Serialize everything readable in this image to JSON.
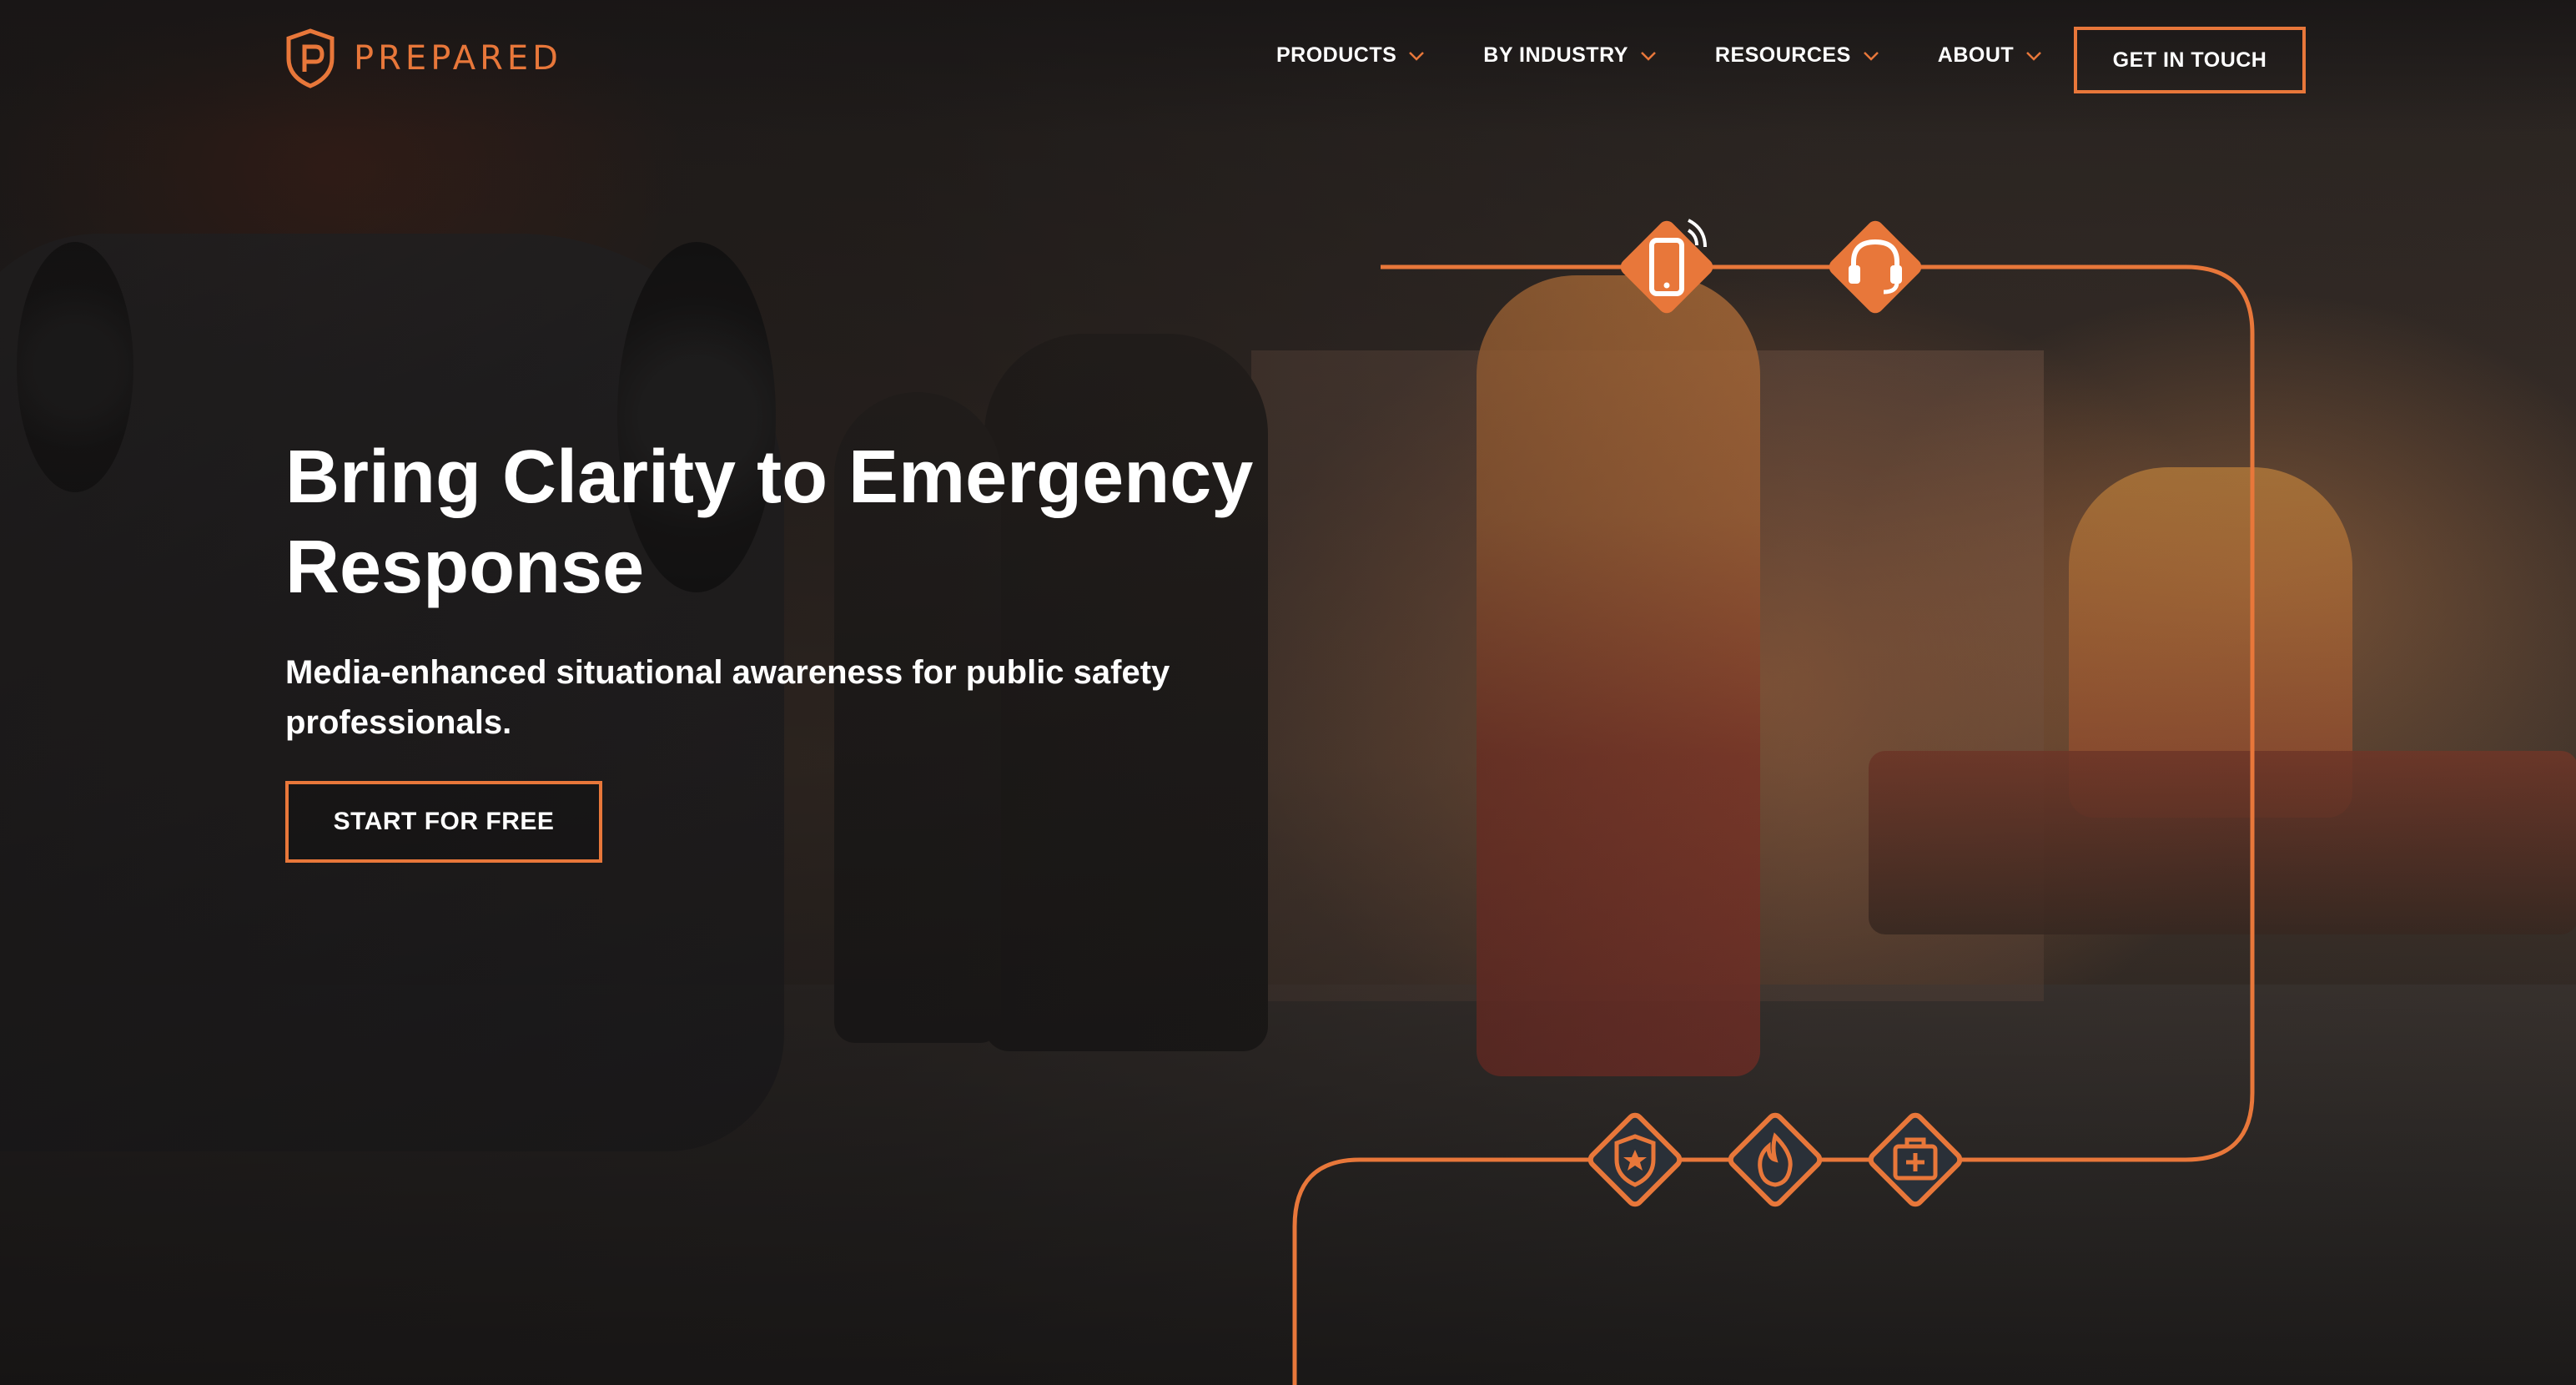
{
  "brand": {
    "name": "PREPARED",
    "accent": "#e8773a",
    "logo_icon": "shield-p-icon"
  },
  "nav": {
    "items": [
      {
        "label": "PRODUCTS",
        "icon": "chevron-down-icon"
      },
      {
        "label": "BY INDUSTRY",
        "icon": "chevron-down-icon"
      },
      {
        "label": "RESOURCES",
        "icon": "chevron-down-icon"
      },
      {
        "label": "ABOUT",
        "icon": "chevron-down-icon"
      }
    ],
    "cta_label": "GET IN TOUCH"
  },
  "hero": {
    "headline_line1": "Bring Clarity to Emergency",
    "headline_line2": "Response",
    "subhead_line1": "Media-enhanced situational awareness for public safety",
    "subhead_line2": "professionals.",
    "cta_label": "START FOR FREE"
  },
  "graphic_icons": [
    {
      "name": "mobile-phone-icon"
    },
    {
      "name": "headset-icon"
    },
    {
      "name": "police-badge-icon"
    },
    {
      "name": "fire-icon"
    },
    {
      "name": "medical-kit-icon"
    }
  ]
}
